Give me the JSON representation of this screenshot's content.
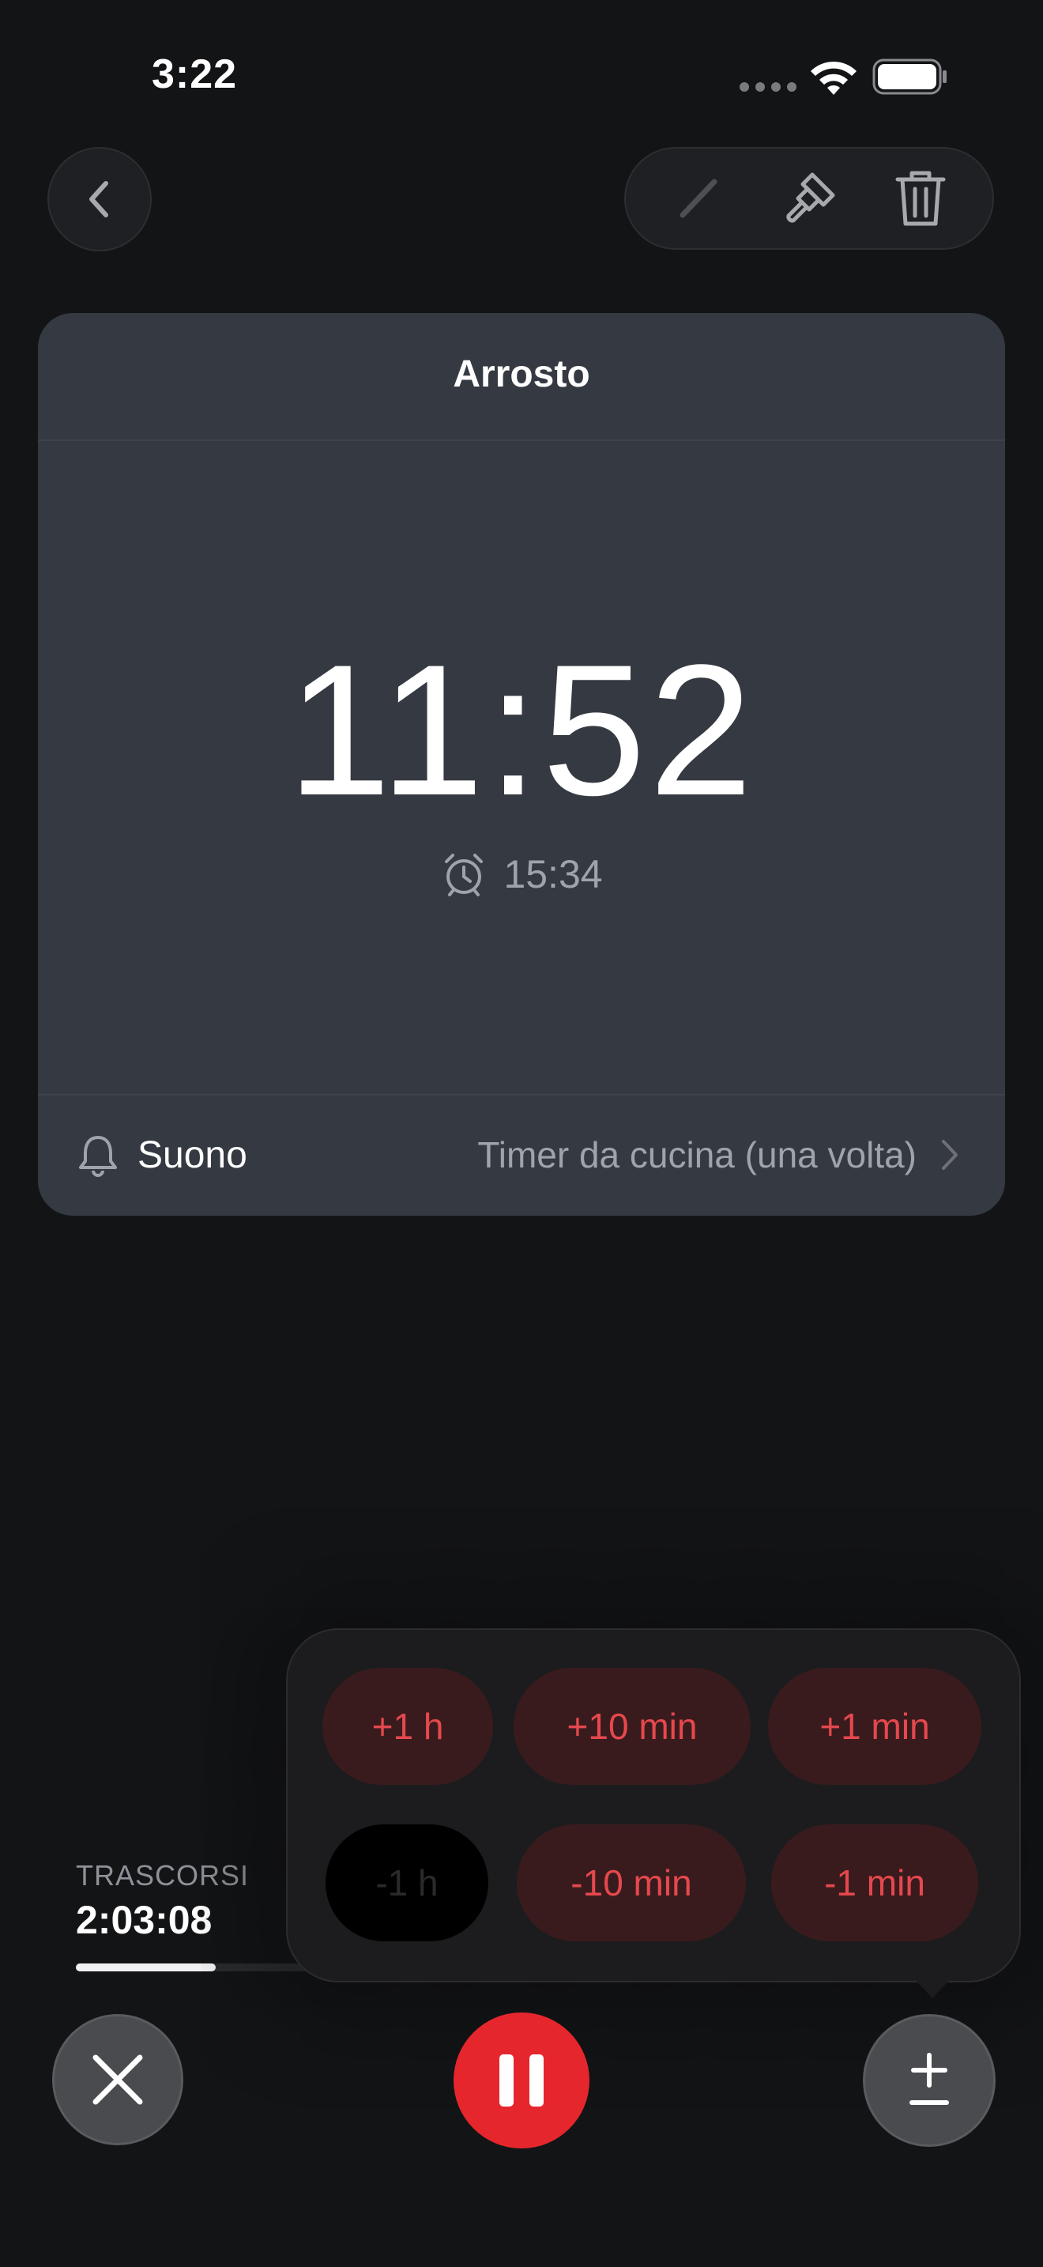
{
  "status_bar": {
    "time": "3:22"
  },
  "timer": {
    "title": "Arrosto",
    "remaining": "11:52",
    "end_time": "15:34",
    "sound_label": "Suono",
    "sound_value": "Timer da cucina (una volta)"
  },
  "elapsed": {
    "label": "TRASCORSI",
    "value": "2:03:08",
    "progress": 0.17
  },
  "adjust_menu": {
    "plus_1h": "+1 h",
    "plus_10min": "+10 min",
    "plus_1min": "+1 min",
    "minus_1h": "-1 h",
    "minus_10min": "-10 min",
    "minus_1min": "-1 min"
  },
  "colors": {
    "accent": "#e5272d",
    "card": "#353a42",
    "background": "#131416"
  }
}
